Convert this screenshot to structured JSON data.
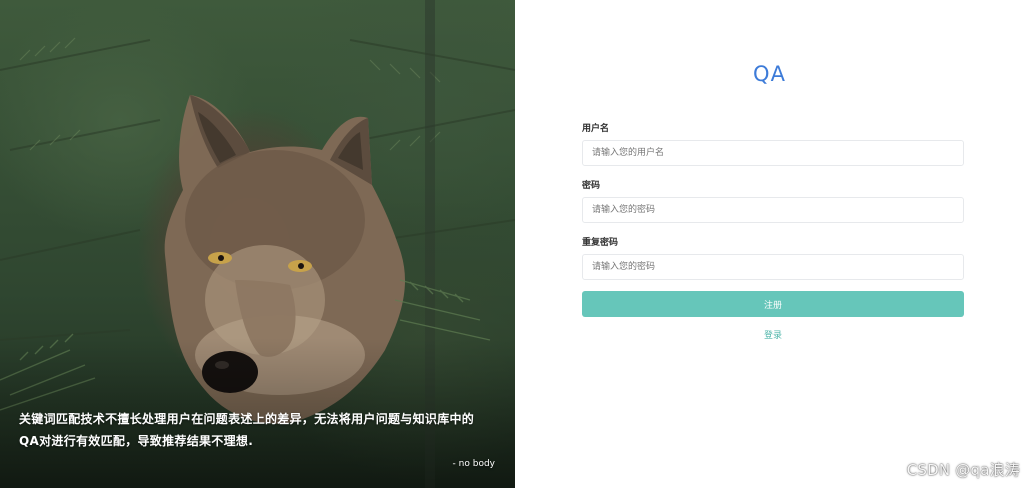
{
  "hero": {
    "quote_line1": "关键词匹配技术不擅长处理用户在问题表述上的差异，无法将用户问题与知识库中的",
    "quote_line2": "QA对进行有效匹配，导致推荐结果不理想.",
    "author": "- no body"
  },
  "brand": {
    "logo_text": "QA",
    "accent_color": "#3d7bd8"
  },
  "form": {
    "username": {
      "label": "用户名",
      "placeholder": "请输入您的用户名",
      "value": ""
    },
    "password": {
      "label": "密码",
      "placeholder": "请输入您的密码",
      "value": ""
    },
    "confirm_password": {
      "label": "重复密码",
      "placeholder": "请输入您的密码",
      "value": ""
    },
    "submit_label": "注册",
    "submit_color": "#66c6ba",
    "login_link": "登录"
  },
  "watermark": "CSDN @qa浪涛"
}
